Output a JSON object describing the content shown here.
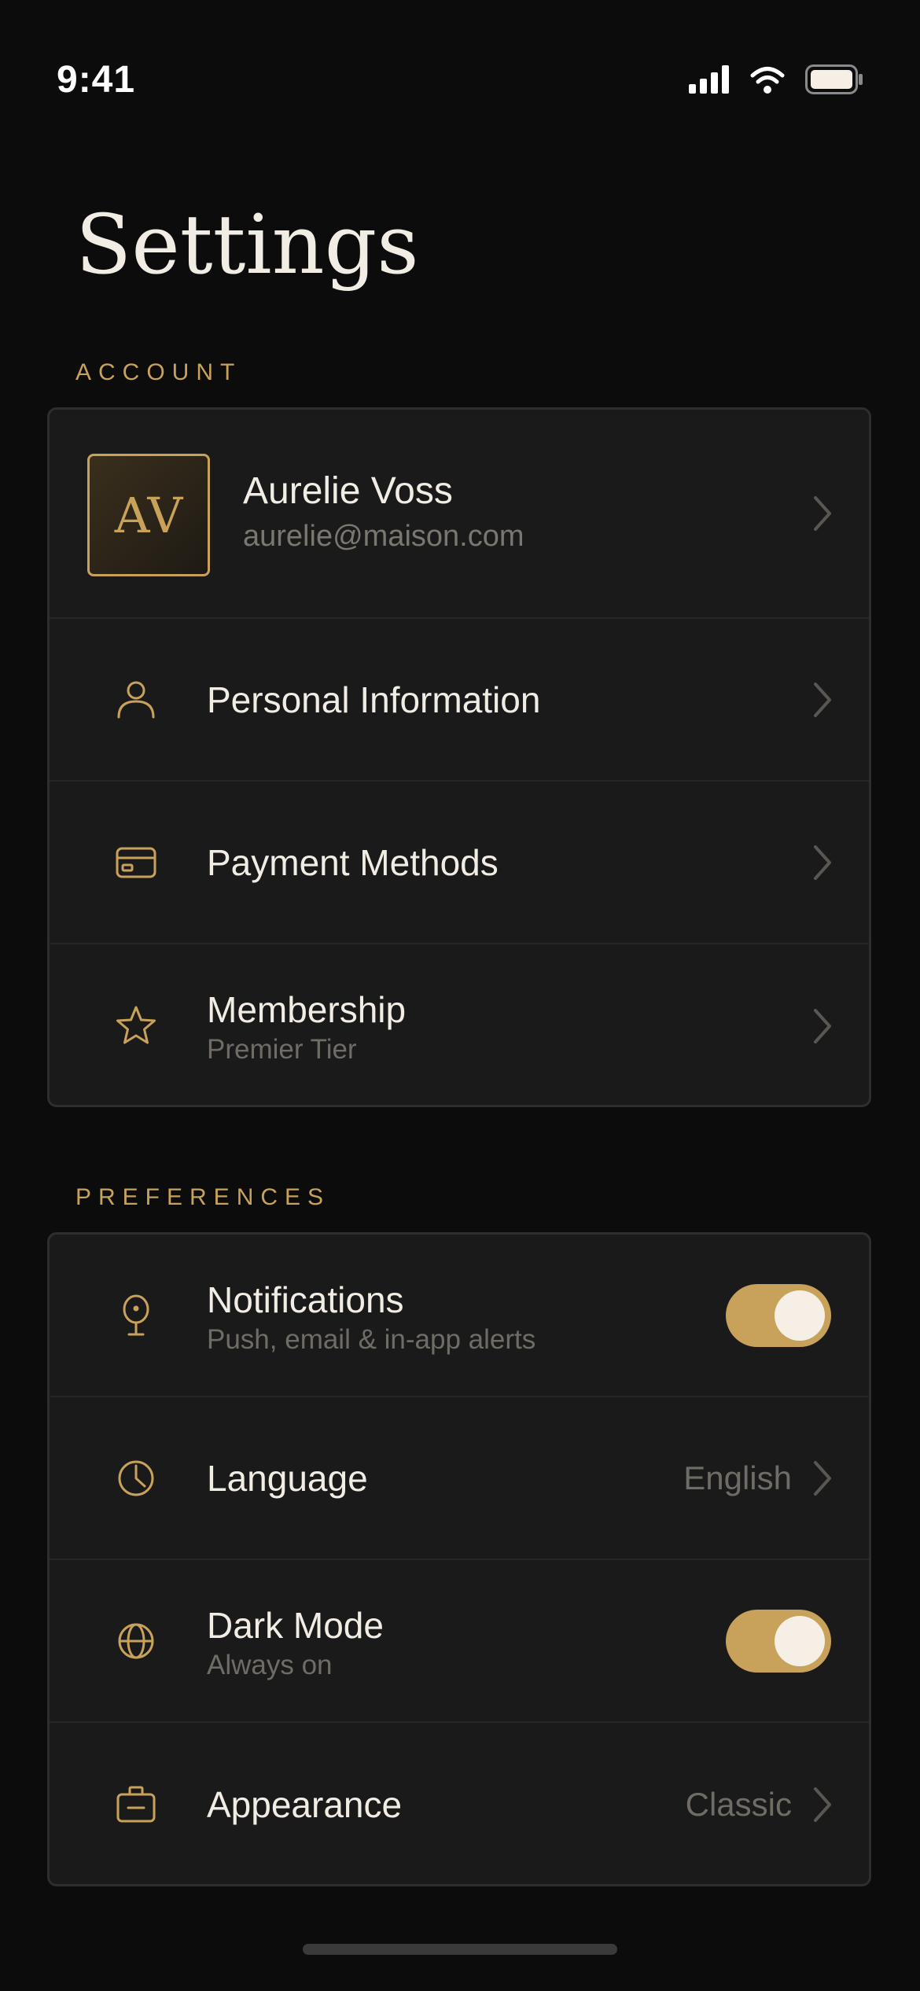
{
  "status_bar": {
    "time": "9:41"
  },
  "page": {
    "title": "Settings"
  },
  "account_section": {
    "label": "ACCOUNT",
    "profile": {
      "initials": "AV",
      "name": "Aurelie Voss",
      "email": "aurelie@maison.com"
    },
    "items": [
      {
        "icon": "person-icon",
        "title": "Personal Information"
      },
      {
        "icon": "credit-card-icon",
        "title": "Payment Methods"
      },
      {
        "icon": "star-icon",
        "title": "Membership",
        "subtitle": "Premier Tier"
      }
    ]
  },
  "preferences_section": {
    "label": "PREFERENCES",
    "items": [
      {
        "icon": "notification-pin-icon",
        "title": "Notifications",
        "subtitle": "Push, email & in-app alerts",
        "toggle_on": true
      },
      {
        "icon": "clock-icon",
        "title": "Language",
        "value": "English"
      },
      {
        "icon": "globe-icon",
        "title": "Dark Mode",
        "subtitle": "Always on",
        "toggle_on": true
      },
      {
        "icon": "briefcase-icon",
        "title": "Appearance",
        "value": "Classic"
      }
    ]
  },
  "colors": {
    "accent": "#c8a25a",
    "background": "#0c0c0c",
    "card": "#1a1a1a",
    "text": "#f2ede4",
    "muted": "#6f6c66"
  }
}
